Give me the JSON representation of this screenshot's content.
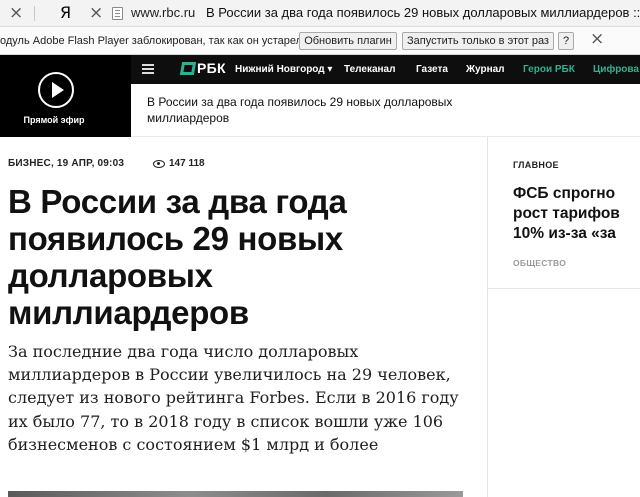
{
  "browser": {
    "close_glyph": "×",
    "yandex_letter": "Я",
    "url": "www.rbc.ru",
    "tab_title": "В России за два года появилось 29 новых долларовых миллиардеров :: Б..."
  },
  "flash_bar": {
    "message": "одуль Adobe Flash Player заблокирован, так как он устарел.",
    "update_button": "Обновить плагин",
    "run_once_button": "Запустить только в этот раз",
    "help_button": "?",
    "close_glyph": "×"
  },
  "header": {
    "live_label": "Прямой эфир",
    "logo_text": "РБК",
    "city": "Нижний Новгород ▾",
    "nav": [
      {
        "label": "Телеканал",
        "highlight": false
      },
      {
        "label": "Газета",
        "highlight": false
      },
      {
        "label": "Журнал",
        "highlight": false
      },
      {
        "label": "Герои РБК",
        "highlight": true
      },
      {
        "label": "Цифрова",
        "highlight": true
      }
    ],
    "accent_color": "#2fb092",
    "background_color": "#0e0e0e"
  },
  "banner": {
    "text": "В России за два года появилось 29 новых долларовых миллиардеров"
  },
  "article": {
    "meta": "БИЗНЕС, 19 АПР, 09:03",
    "views": "147 118",
    "title": "В России за два года появилось 29 новых долларовых миллиардеров",
    "lead": "За последние два года число долларовых миллиардеров в России увеличилось на 29 человек, следует из нового рейтинга Forbes. Если в 2016 году их было 77, то в 2018 году в список вошли уже 106 бизнесменов с состоянием $1 млрд и более"
  },
  "sidebar": {
    "label": "ГЛАВНОЕ",
    "headline_lines": [
      "ФСБ спрогно",
      "рост тарифов",
      "10% из-за «за"
    ],
    "section": "ОБЩЕСТВО"
  }
}
